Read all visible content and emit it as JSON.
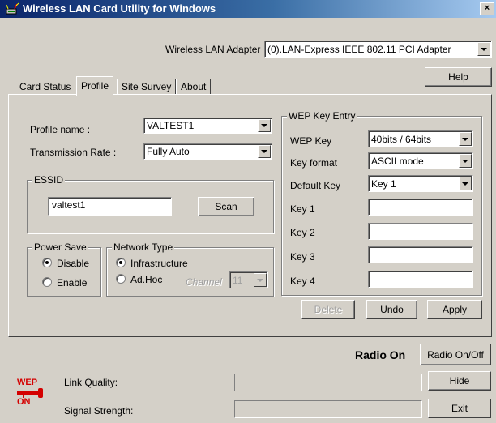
{
  "window": {
    "title": "Wireless LAN Card Utility for Windows",
    "close_glyph": "×"
  },
  "adapter": {
    "label": "Wireless LAN Adapter",
    "selected": "(0).LAN-Express IEEE 802.11 PCI Adapter"
  },
  "help_label": "Help",
  "tabs": [
    {
      "label": "Card Status",
      "active": false
    },
    {
      "label": "Profile",
      "active": true
    },
    {
      "label": "Site Survey",
      "active": false
    },
    {
      "label": "About",
      "active": false
    }
  ],
  "profile": {
    "name_label": "Profile name :",
    "name_value": "VALTEST1",
    "rate_label": "Transmission Rate :",
    "rate_value": "Fully Auto"
  },
  "essid": {
    "legend": "ESSID",
    "value": "valtest1",
    "scan_label": "Scan"
  },
  "power_save": {
    "legend": "Power Save",
    "options": [
      {
        "label": "Disable",
        "checked": true
      },
      {
        "label": "Enable",
        "checked": false
      }
    ]
  },
  "network_type": {
    "legend": "Network Type",
    "options": [
      {
        "label": "Infrastructure",
        "checked": true
      },
      {
        "label": "Ad.Hoc",
        "checked": false
      }
    ],
    "channel_label": "Channel",
    "channel_value": "11"
  },
  "wep": {
    "legend": "WEP Key Entry",
    "wep_key_label": "WEP Key",
    "wep_key_value": "40bits / 64bits",
    "key_format_label": "Key format",
    "key_format_value": "ASCII mode",
    "default_key_label": "Default Key",
    "default_key_value": "Key 1",
    "keys": [
      {
        "label": "Key 1",
        "value": ""
      },
      {
        "label": "Key 2",
        "value": ""
      },
      {
        "label": "Key 3",
        "value": ""
      },
      {
        "label": "Key 4",
        "value": ""
      }
    ]
  },
  "actions": {
    "delete_label": "Delete",
    "undo_label": "Undo",
    "apply_label": "Apply"
  },
  "radio": {
    "status": "Radio On",
    "toggle_label": "Radio On/Off"
  },
  "status": {
    "icon_text_top": "WEP",
    "icon_text_bottom": "ON",
    "link_quality_label": "Link Quality:",
    "link_quality_value": 0,
    "signal_strength_label": "Signal Strength:",
    "signal_strength_value": 0,
    "hide_label": "Hide",
    "exit_label": "Exit"
  },
  "colors": {
    "title_start": "#0a246a",
    "title_end": "#a6caf0",
    "face": "#d4d0c8",
    "wep_icon_red": "#d40000"
  }
}
